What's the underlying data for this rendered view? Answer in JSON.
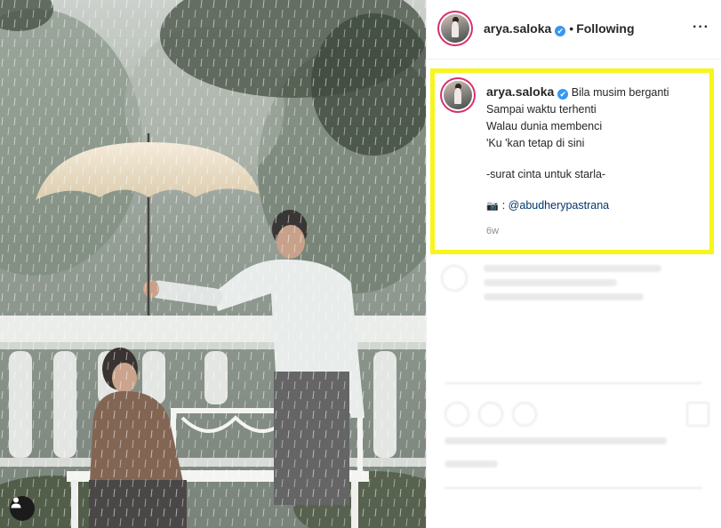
{
  "post": {
    "username": "arya.saloka",
    "verified_mark": "✔",
    "separator": "•",
    "follow_status": "Following",
    "more_label": "···"
  },
  "caption": {
    "username": "arya.saloka",
    "lines": [
      "Bila musim berganti",
      "Sampai waktu terhenti",
      "Walau dunia membenci",
      "'Ku 'kan tetap di sini"
    ],
    "signature": "-surat cinta untuk starla-",
    "camera_glyph": "📷",
    "credit_sep": ":",
    "credit_mention": "@abudherypastrana",
    "age": "6w"
  },
  "icons": {
    "tag": "user-tag-icon",
    "verified": "verified-badge-icon",
    "more": "more-options-icon",
    "camera": "camera-icon"
  },
  "colors": {
    "highlight": "#f7f51c",
    "mention": "#00376b",
    "verified": "#3897f0",
    "story_ring": "#d6306e"
  }
}
